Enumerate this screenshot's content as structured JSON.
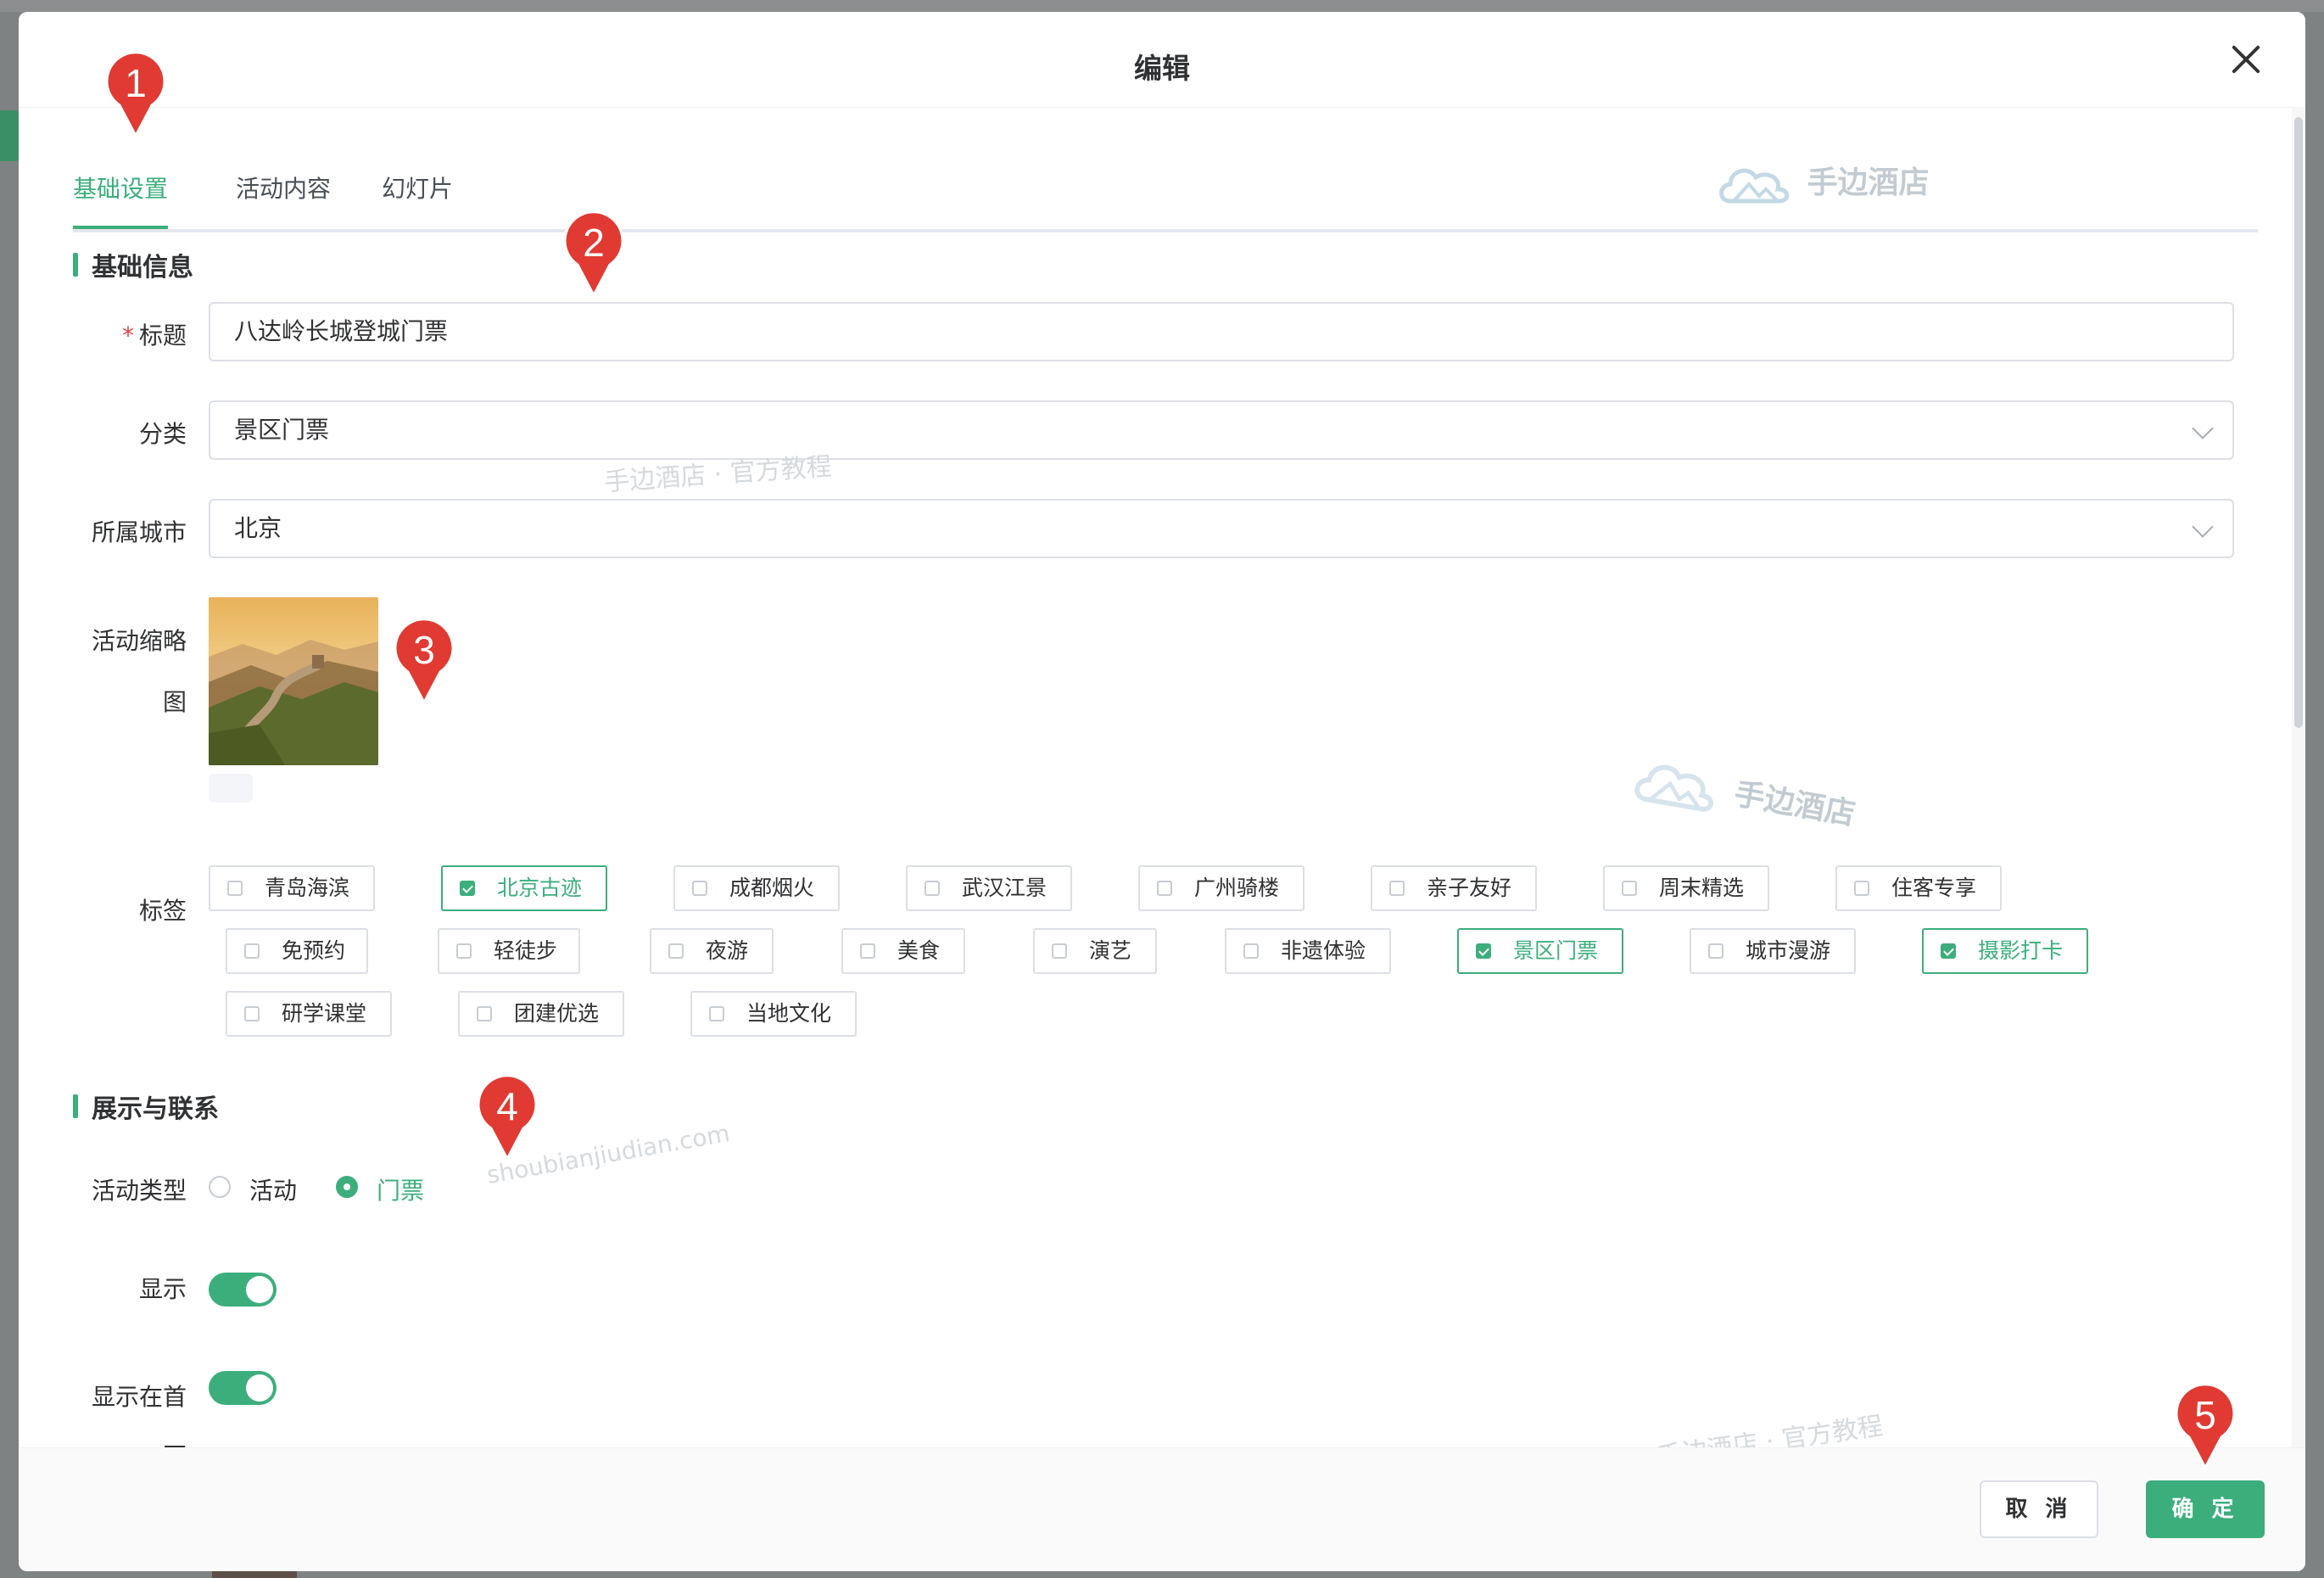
{
  "dialog": {
    "title": "编辑"
  },
  "tabs": [
    {
      "label": "基础设置",
      "active": true
    },
    {
      "label": "活动内容",
      "active": false
    },
    {
      "label": "幻灯片",
      "active": false
    }
  ],
  "sections": {
    "basic_info": "基础信息",
    "display_contact": "展示与联系"
  },
  "form": {
    "title_label": "标题",
    "required_mark": "*",
    "title_value": "八达岭长城登城门票",
    "category_label": "分类",
    "category_value": "景区门票",
    "city_label": "所属城市",
    "city_value": "北京",
    "thumbnail_label_line1": "活动缩略",
    "thumbnail_label_line2": "图",
    "tags_label": "标签",
    "activity_type_label": "活动类型",
    "show_label": "显示",
    "show_home_label_line1": "显示在首",
    "show_home_label_line2": "页"
  },
  "tags": [
    {
      "label": "青岛海滨",
      "checked": false
    },
    {
      "label": "北京古迹",
      "checked": true
    },
    {
      "label": "成都烟火",
      "checked": false
    },
    {
      "label": "武汉江景",
      "checked": false
    },
    {
      "label": "广州骑楼",
      "checked": false
    },
    {
      "label": "亲子友好",
      "checked": false
    },
    {
      "label": "周末精选",
      "checked": false
    },
    {
      "label": "住客专享",
      "checked": false
    },
    {
      "label": "免预约",
      "checked": false
    },
    {
      "label": "轻徒步",
      "checked": false
    },
    {
      "label": "夜游",
      "checked": false
    },
    {
      "label": "美食",
      "checked": false
    },
    {
      "label": "演艺",
      "checked": false
    },
    {
      "label": "非遗体验",
      "checked": false
    },
    {
      "label": "景区门票",
      "checked": true
    },
    {
      "label": "城市漫游",
      "checked": false
    },
    {
      "label": "摄影打卡",
      "checked": true
    },
    {
      "label": "研学课堂",
      "checked": false
    },
    {
      "label": "团建优选",
      "checked": false
    },
    {
      "label": "当地文化",
      "checked": false
    }
  ],
  "activity_type": {
    "options": [
      "活动",
      "门票"
    ],
    "selected": "门票"
  },
  "switches": {
    "show": true,
    "show_on_home": true
  },
  "footer": {
    "cancel_label": "取 消",
    "ok_label": "确 定"
  },
  "markers": [
    "1",
    "2",
    "3",
    "4",
    "5"
  ],
  "watermarks": {
    "brand": "手边酒店",
    "tutorial": "手边酒店 · 官方教程",
    "domain": "shoubianjiudian.com"
  },
  "colors": {
    "accent": "#3cae7c",
    "marker": "#e03a33",
    "required": "#e64545"
  }
}
